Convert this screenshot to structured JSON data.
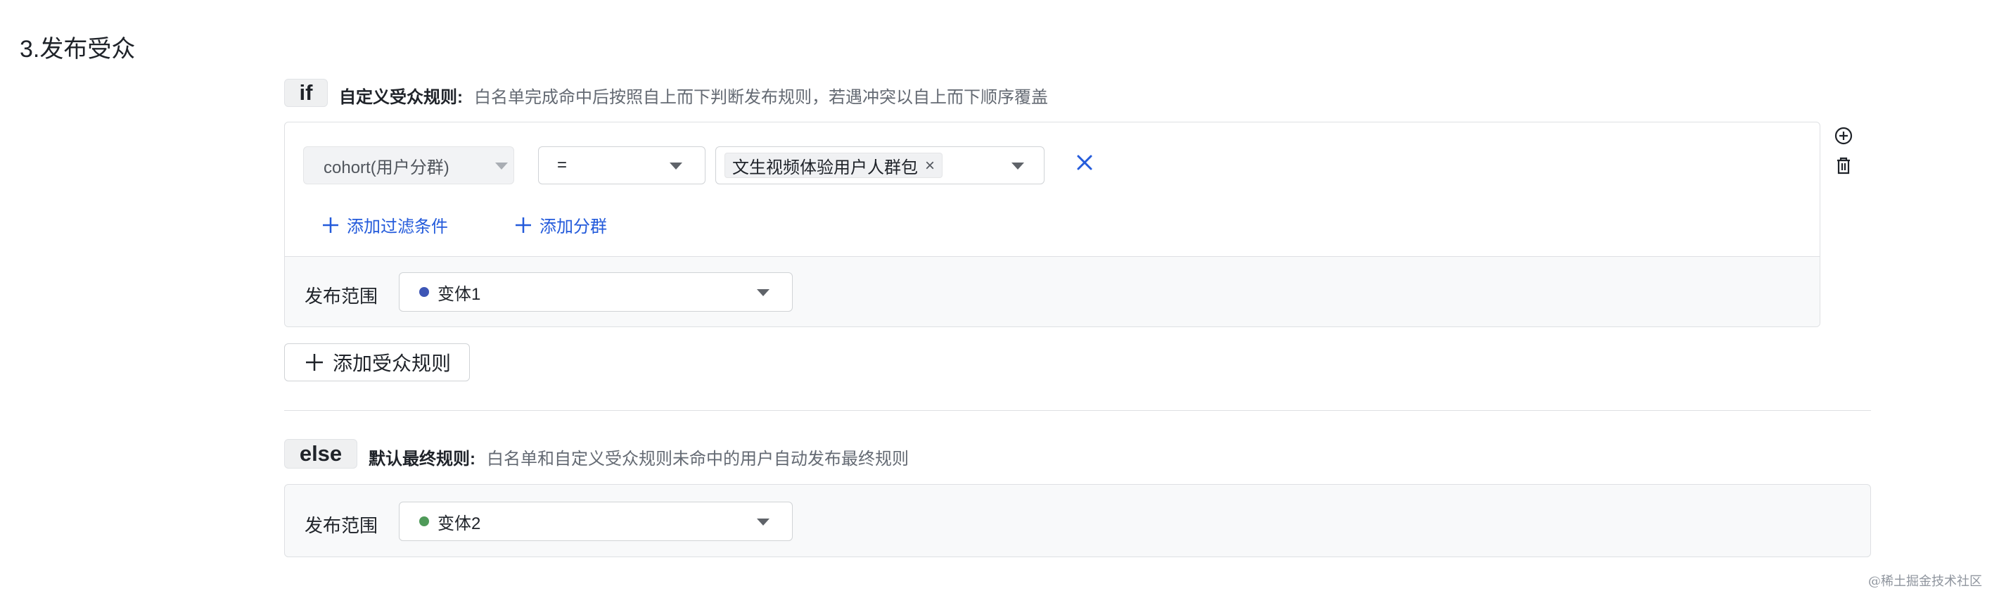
{
  "section": {
    "title": "3.发布受众"
  },
  "if_block": {
    "badge": "if",
    "rule_label": "自定义受众规则:",
    "rule_desc": "白名单完成命中后按照自上而下判断发布规则，若遇冲突以自上而下顺序覆盖",
    "condition": {
      "field": "cohort(用户分群)",
      "operator": "=",
      "value_tag": "文生视频体验用户人群包"
    },
    "add_filter_label": "添加过滤条件",
    "add_group_label": "添加分群",
    "range_label": "发布范围",
    "variant": "变体1",
    "variant_color": "#3d56b6"
  },
  "add_rule_button": "添加受众规则",
  "else_block": {
    "badge": "else",
    "rule_label": "默认最终规则:",
    "rule_desc": "白名单和自定义受众规则未命中的用户自动发布最终规则",
    "range_label": "发布范围",
    "variant": "变体2",
    "variant_color": "#4f9a59"
  },
  "watermark": "@稀土掘金技术社区",
  "colors": {
    "link": "#245bdb",
    "border": "#dee0e3",
    "footer_bg": "#f8f9fa"
  }
}
